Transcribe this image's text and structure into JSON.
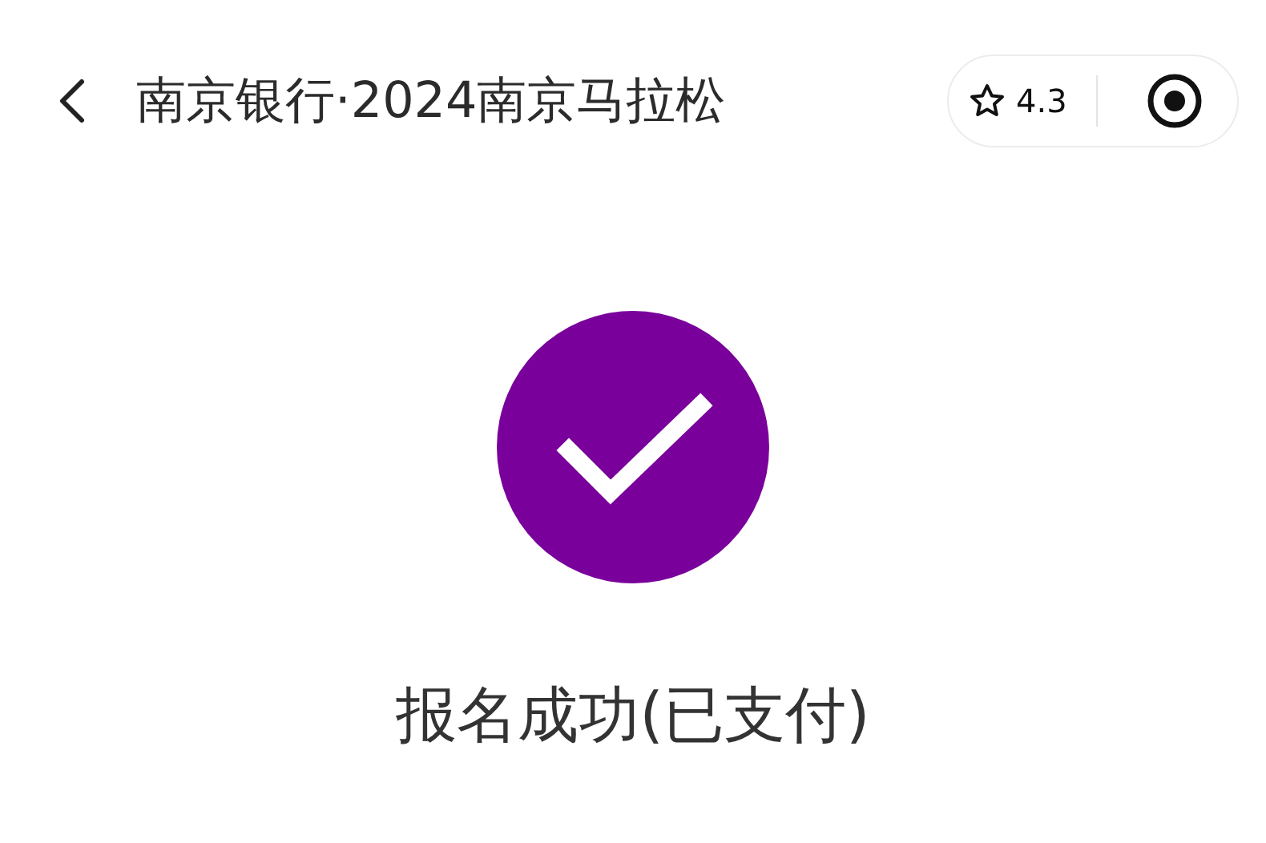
{
  "header": {
    "title": "南京银行·2024南京马拉松",
    "rating": "4.3"
  },
  "result": {
    "status": "报名成功(已支付)",
    "success": true
  }
}
